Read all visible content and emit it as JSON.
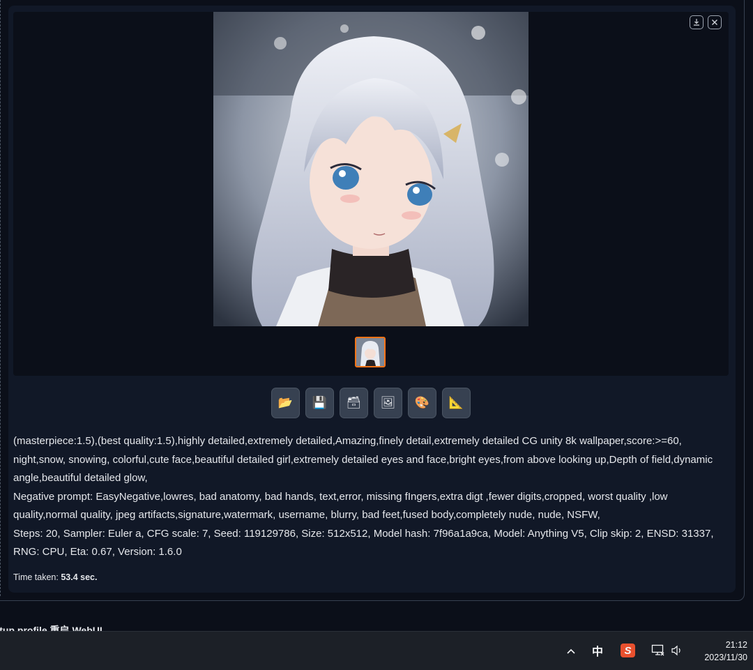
{
  "gallery": {
    "download_icon": "download-icon",
    "close_icon": "close-icon"
  },
  "actions": [
    {
      "icon": "folder-icon",
      "glyph": "📂"
    },
    {
      "icon": "save-icon",
      "glyph": "💾"
    },
    {
      "icon": "zip-icon",
      "glyph": "🗃"
    },
    {
      "icon": "image-icon",
      "glyph": "🖼"
    },
    {
      "icon": "palette-icon",
      "glyph": "🎨"
    },
    {
      "icon": "triangle-ruler-icon",
      "glyph": "📐"
    }
  ],
  "generation_info": {
    "prompt": "(masterpiece:1.5),(best quality:1.5),highly detailed,extremely detailed,Amazing,finely detail,extremely detailed CG unity 8k wallpaper,score:>=60, night,snow, snowing, colorful,cute face,beautiful detailed girl,extremely detailed eyes and face,bright eyes,from above looking up,Depth of field,dynamic angle,beautiful detailed glow,",
    "negative": "Negative prompt: EasyNegative,lowres, bad anatomy, bad hands, text,error, missing fIngers,extra digt ,fewer digits,cropped, worst quality ,low quality,normal quality, jpeg artifacts,signature,watermark, username, blurry, bad feet,fused body,completely nude, nude, NSFW,",
    "params": "Steps: 20, Sampler: Euler a, CFG scale: 7, Seed: 119129786, Size: 512x512, Model hash: 7f96a1a9ca, Model: Anything V5, Clip skip: 2, ENSD: 31337, RNG: CPU, Eta: 0.67, Version: 1.6.0"
  },
  "time_taken": {
    "label": "Time taken: ",
    "value": "53.4 sec."
  },
  "footer_text": "artup profile    重启 WebUI",
  "taskbar": {
    "ime": "中",
    "sogou": "S",
    "time": "21:12",
    "date": "2023/11/30"
  }
}
